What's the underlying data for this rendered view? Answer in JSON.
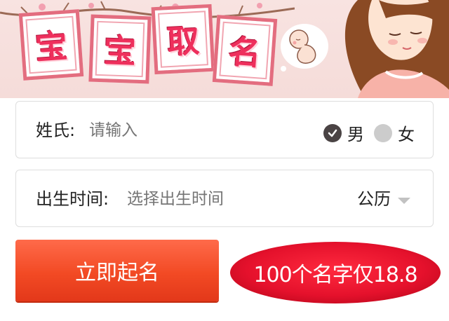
{
  "banner": {
    "title_chars": [
      "宝",
      "宝",
      "取",
      "名"
    ]
  },
  "surname": {
    "label": "姓氏:",
    "placeholder": "请输入",
    "gender_options": [
      {
        "label": "男",
        "selected": true
      },
      {
        "label": "女",
        "selected": false
      }
    ]
  },
  "birth": {
    "label": "出生时间:",
    "placeholder": "选择出生时间",
    "calendar_value": "公历"
  },
  "cta": {
    "label": "立即起名"
  },
  "promo": {
    "text": "100个名字仅18.8"
  },
  "colors": {
    "accent": "#f24a24",
    "title_red": "#ee2f5c",
    "promo_red": "#e5112c",
    "radio_selected": "#4a4344",
    "radio_unselected": "#cccccc"
  }
}
